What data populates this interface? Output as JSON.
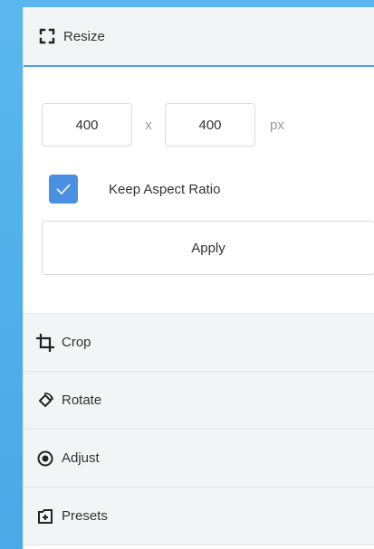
{
  "resize": {
    "title": "Resize",
    "width_value": "400",
    "height_value": "400",
    "separator": "x",
    "unit": "px",
    "keep_aspect_label": "Keep Aspect Ratio",
    "keep_aspect_checked": true,
    "apply_label": "Apply",
    "accent_color": "#4a90e2"
  },
  "sections": [
    {
      "label": "Crop",
      "icon": "crop-icon"
    },
    {
      "label": "Rotate",
      "icon": "rotate-icon"
    },
    {
      "label": "Adjust",
      "icon": "adjust-icon"
    },
    {
      "label": "Presets",
      "icon": "presets-icon"
    }
  ]
}
